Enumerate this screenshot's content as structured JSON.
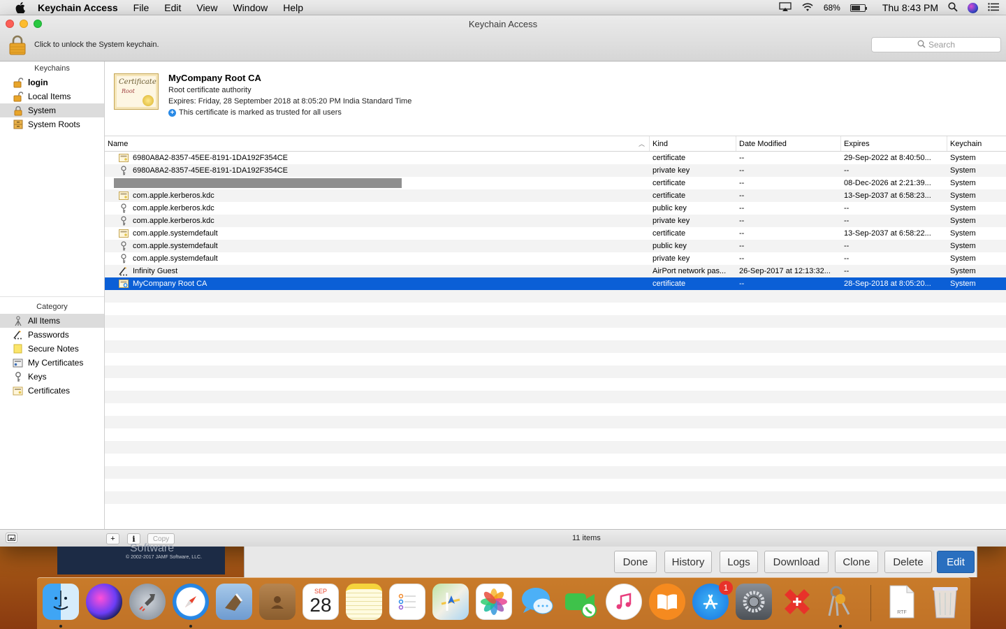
{
  "menubar": {
    "app": "Keychain Access",
    "items": [
      "File",
      "Edit",
      "View",
      "Window",
      "Help"
    ],
    "battery": "68%",
    "clock": "Thu 8:43 PM"
  },
  "window": {
    "title": "Keychain Access",
    "lock_message": "Click to unlock the System keychain.",
    "search_placeholder": "Search"
  },
  "sidebar": {
    "keychains_header": "Keychains",
    "keychains": [
      {
        "label": "login",
        "icon": "lock-open-icon"
      },
      {
        "label": "Local Items",
        "icon": "lock-open-icon"
      },
      {
        "label": "System",
        "icon": "lock-closed-icon"
      },
      {
        "label": "System Roots",
        "icon": "cabinet-icon"
      }
    ],
    "category_header": "Category",
    "categories": [
      {
        "label": "All Items",
        "icon": "all-items-icon"
      },
      {
        "label": "Passwords",
        "icon": "password-icon"
      },
      {
        "label": "Secure Notes",
        "icon": "note-icon"
      },
      {
        "label": "My Certificates",
        "icon": "my-certificate-icon"
      },
      {
        "label": "Keys",
        "icon": "key-icon"
      },
      {
        "label": "Certificates",
        "icon": "certificate-icon"
      }
    ]
  },
  "detail": {
    "name": "MyCompany Root CA",
    "subtitle": "Root certificate authority",
    "expires": "Expires: Friday, 28 September 2018 at 8:05:20 PM India Standard Time",
    "trust": "This certificate is marked as trusted for all users",
    "cert_title": "Certificate",
    "cert_sub": "Root"
  },
  "table": {
    "columns": [
      "Name",
      "Kind",
      "Date Modified",
      "Expires",
      "Keychain"
    ],
    "rows": [
      {
        "name": "6980A8A2-8357-45EE-8191-1DA192F354CE",
        "kind": "certificate",
        "modified": "--",
        "expires": "29-Sep-2022 at 8:40:50...",
        "keychain": "System",
        "icon": "certificate"
      },
      {
        "name": "6980A8A2-8357-45EE-8191-1DA192F354CE",
        "kind": "private key",
        "modified": "--",
        "expires": "--",
        "keychain": "System",
        "icon": "key"
      },
      {
        "name": "",
        "kind": "certificate",
        "modified": "--",
        "expires": "08-Dec-2026 at 2:21:39...",
        "keychain": "System",
        "icon": "redacted"
      },
      {
        "name": "com.apple.kerberos.kdc",
        "kind": "certificate",
        "modified": "--",
        "expires": "13-Sep-2037 at 6:58:23...",
        "keychain": "System",
        "icon": "certificate"
      },
      {
        "name": "com.apple.kerberos.kdc",
        "kind": "public key",
        "modified": "--",
        "expires": "--",
        "keychain": "System",
        "icon": "key"
      },
      {
        "name": "com.apple.kerberos.kdc",
        "kind": "private key",
        "modified": "--",
        "expires": "--",
        "keychain": "System",
        "icon": "key"
      },
      {
        "name": "com.apple.systemdefault",
        "kind": "certificate",
        "modified": "--",
        "expires": "13-Sep-2037 at 6:58:22...",
        "keychain": "System",
        "icon": "certificate"
      },
      {
        "name": "com.apple.systemdefault",
        "kind": "public key",
        "modified": "--",
        "expires": "--",
        "keychain": "System",
        "icon": "key"
      },
      {
        "name": "com.apple.systemdefault",
        "kind": "private key",
        "modified": "--",
        "expires": "--",
        "keychain": "System",
        "icon": "key"
      },
      {
        "name": "Infinity Guest",
        "kind": "AirPort network pas...",
        "modified": "26-Sep-2017 at 12:13:32...",
        "expires": "--",
        "keychain": "System",
        "icon": "password"
      },
      {
        "name": "MyCompany Root CA",
        "kind": "certificate",
        "modified": "--",
        "expires": "28-Sep-2018 at 8:05:20...",
        "keychain": "System",
        "icon": "certificate-plus",
        "selected": true
      }
    ]
  },
  "bottombar": {
    "copy_label": "Copy",
    "item_count": "11 items",
    "info_label": "i",
    "add_label": "+"
  },
  "background_app": {
    "copyright": "© 2002-2017 JAMF Software, LLC.",
    "logo_text": "Software",
    "buttons": [
      "Done",
      "History",
      "Logs",
      "Download",
      "Clone",
      "Delete",
      "Edit"
    ]
  },
  "dock": {
    "apps": [
      "Finder",
      "Siri",
      "Launchpad",
      "Safari",
      "Mail",
      "Contacts",
      "Calendar",
      "Notes",
      "Reminders",
      "Maps",
      "Photos",
      "Messages",
      "FaceTime",
      "iTunes",
      "iBooks",
      "App Store",
      "System Preferences",
      "Self Service",
      "Keychain Access",
      "Documents",
      "Trash"
    ],
    "calendar_month": "SEP",
    "calendar_day": "28",
    "appstore_badge": "1",
    "doc_label": "RTF"
  }
}
